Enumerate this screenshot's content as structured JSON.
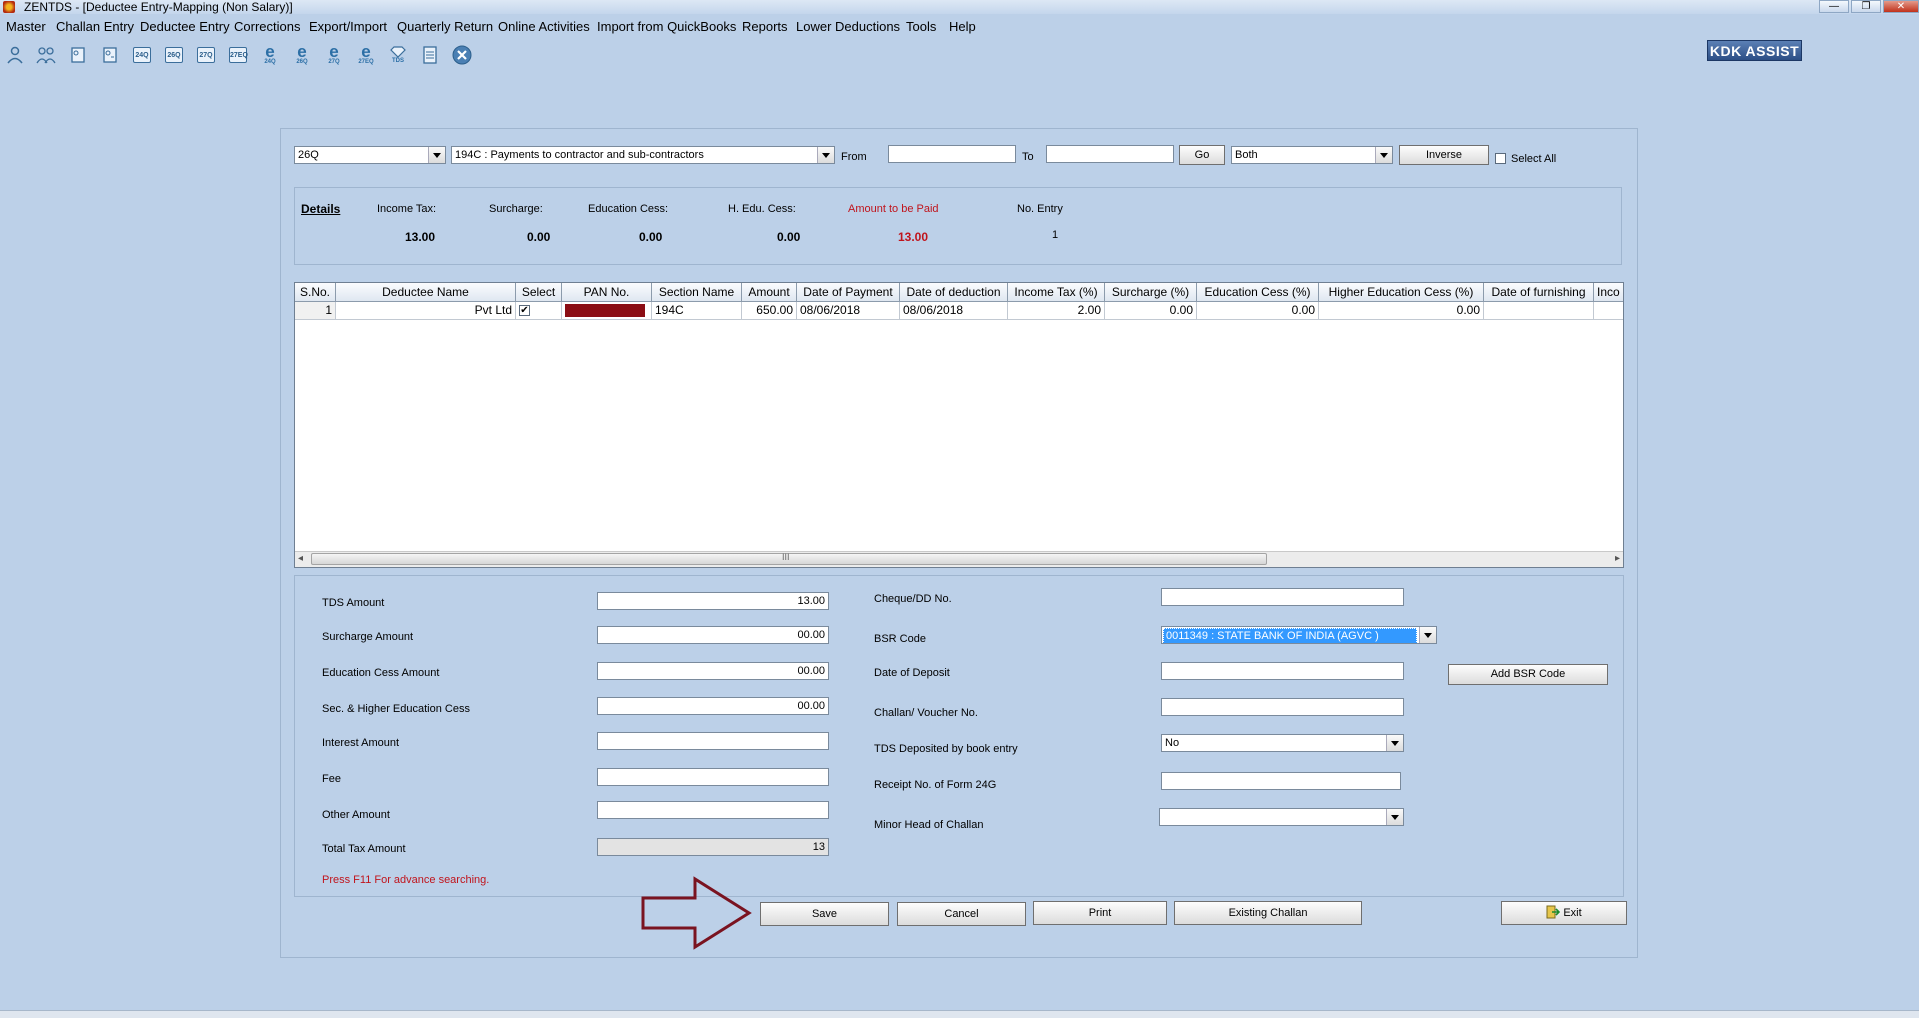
{
  "window": {
    "title": "ZENTDS - [Deductee Entry-Mapping (Non Salary)]",
    "controls": [
      "—",
      "❐",
      "✕"
    ]
  },
  "menu": [
    "Master",
    "Challan Entry",
    "Deductee Entry",
    "Corrections",
    "Export/Import",
    "Quarterly Return",
    "Online Activities",
    "Import from QuickBooks",
    "Reports",
    "Lower Deductions",
    "Tools",
    "Help"
  ],
  "toolbar": {
    "icons": [
      "user-icon",
      "users-icon",
      "form-icon",
      "form-icon-2",
      "24q-icon",
      "26q-icon",
      "27q-icon",
      "27eq-icon",
      "e24q-icon",
      "e26q-icon",
      "e27q-icon",
      "e27eq-icon",
      "tds-icon",
      "report-icon",
      "close-circle-icon"
    ],
    "icon_labels": [
      "24Q",
      "26Q",
      "27Q",
      "27EQ"
    ],
    "e_labels": [
      "24Q",
      "26Q",
      "27Q",
      "27EQ"
    ],
    "tds_label": "TDS",
    "brand": "KDK ASSIST"
  },
  "filters": {
    "form_type": "26Q",
    "section": "194C : Payments to contractor and sub-contractors",
    "from_label": "From",
    "from_value": "",
    "to_label": "To",
    "to_value": "",
    "go_label": "Go",
    "mode": "Both",
    "inverse_label": "Inverse",
    "select_all_label": "Select All"
  },
  "details": {
    "heading": "Details",
    "income_tax_label": "Income Tax:",
    "income_tax": "13.00",
    "surcharge_label": "Surcharge:",
    "surcharge": "0.00",
    "education_cess_label": "Education Cess:",
    "education_cess": "0.00",
    "h_edu_cess_label": "H. Edu. Cess:",
    "h_edu_cess": "0.00",
    "amount_paid_label": "Amount to be Paid",
    "amount_paid": "13.00",
    "no_entry_label": "No. Entry",
    "no_entry": "1"
  },
  "grid": {
    "columns": [
      "S.No.",
      "Deductee Name",
      "Select",
      "PAN No.",
      "Section Name",
      "Amount",
      "Date of Payment",
      "Date of deduction",
      "Income Tax (%)",
      "Surcharge (%)",
      "Education Cess (%)",
      "Higher Education Cess (%)",
      "Date of furnishing",
      "Inco"
    ],
    "rows": [
      {
        "sno": "1",
        "name": "Pvt Ltd",
        "selected": "✔",
        "pan": "",
        "section": "194C",
        "amount": "650.00",
        "date_payment": "08/06/2018",
        "date_deduction": "08/06/2018",
        "income_tax": "2.00",
        "surcharge": "0.00",
        "edu_cess": "0.00",
        "higher_edu_cess": "0.00",
        "date_furnishing": "",
        "inco": ""
      }
    ],
    "scroll_grip": "III",
    "scroll_right": "▸",
    "scroll_left": "◂"
  },
  "form": {
    "tds_amount_label": "TDS Amount",
    "tds_amount": "13.00",
    "surcharge_amount_label": "Surcharge Amount",
    "surcharge_amount": "00.00",
    "education_cess_amount_label": "Education Cess Amount",
    "education_cess_amount": "00.00",
    "sec_higher_edu_label": "Sec. & Higher Education Cess",
    "sec_higher_edu": "00.00",
    "interest_label": "Interest Amount",
    "interest": "",
    "fee_label": "Fee",
    "fee": "",
    "other_label": "Other Amount",
    "other": "",
    "total_label": "Total Tax Amount",
    "total": "13",
    "hint": "Press F11 For advance searching.",
    "cheque_label": "Cheque/DD No.",
    "cheque": "",
    "bsr_label": "BSR Code",
    "bsr": "0011349 : STATE BANK OF INDIA (AGVC )",
    "deposit_label": "Date of Deposit",
    "deposit": "",
    "add_bsr_label": "Add BSR Code",
    "challan_label": "Challan/ Voucher No.",
    "challan": "",
    "book_entry_label": "TDS Deposited by book entry",
    "book_entry": "No",
    "receipt_label": "Receipt No. of Form 24G",
    "receipt": "",
    "minor_head_label": "Minor Head of Challan",
    "minor_head": ""
  },
  "actions": {
    "save": "Save",
    "cancel": "Cancel",
    "print": "Print",
    "existing": "Existing Challan",
    "exit": "Exit"
  },
  "colors": {
    "background": "#bcd0e8",
    "accent_red": "#c0141c",
    "selection_blue": "#3399ff",
    "pan_mask": "#8b0d14",
    "arrow": "#7a1320"
  }
}
